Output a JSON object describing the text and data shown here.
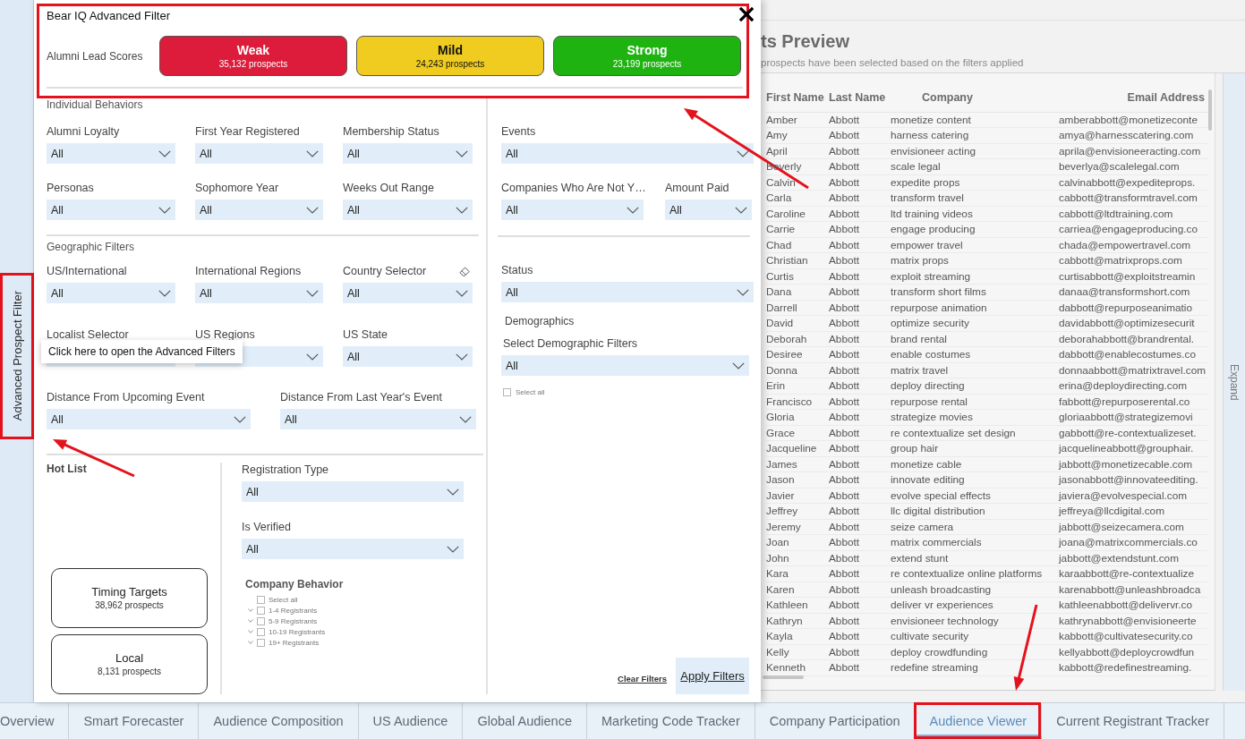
{
  "sidebar": {
    "label": "Advanced Prospect Filter"
  },
  "tooltip": {
    "text": "Click here to open the Advanced Filters"
  },
  "filter_panel": {
    "title": "Bear IQ Advanced Filter",
    "lead_scores": {
      "label": "Alumni Lead Scores",
      "buttons": [
        {
          "label": "Weak",
          "count": "35,132 prospects",
          "color": "#dc1c3a"
        },
        {
          "label": "Mild",
          "count": "24,243 prospects",
          "color": "#efcc1f"
        },
        {
          "label": "Strong",
          "count": "23,199 prospects",
          "color": "#1fb312"
        }
      ]
    },
    "individual_behaviors": {
      "heading": "Individual Behaviors",
      "filters": [
        {
          "label": "Alumni Loyalty",
          "value": "All"
        },
        {
          "label": "First Year Registered",
          "value": "All"
        },
        {
          "label": "Membership Status",
          "value": "All"
        },
        {
          "label": "Personas",
          "value": "All"
        },
        {
          "label": "Sophomore Year",
          "value": "All"
        },
        {
          "label": "Weeks Out Range",
          "value": "All"
        }
      ]
    },
    "geographic_filters": {
      "heading": "Geographic Filters",
      "filters": [
        {
          "label": "US/International",
          "value": "All",
          "clearable": false
        },
        {
          "label": "International Regions",
          "value": "All",
          "clearable": false
        },
        {
          "label": "Country Selector",
          "value": "All",
          "clearable": true
        },
        {
          "label": "Localist Selector",
          "clearable": false
        },
        {
          "label": "US Regions",
          "clearable": false
        },
        {
          "label": "US State",
          "value": "All",
          "clearable": false
        }
      ],
      "distance_filters": [
        {
          "label": "Distance From Upcoming Event",
          "value": "All"
        },
        {
          "label": "Distance From Last Year's Event",
          "value": "All"
        }
      ]
    },
    "hot_list": {
      "heading": "Hot List",
      "cards": [
        {
          "title": "Timing Targets",
          "count": "38,962 prospects"
        },
        {
          "title": "Local",
          "count": "8,131 prospects"
        }
      ]
    },
    "registration_filters": [
      {
        "label": "Registration Type",
        "value": "All"
      },
      {
        "label": "Is Verified",
        "value": "All"
      }
    ],
    "company_behavior": {
      "heading": "Company Behavior",
      "items": [
        {
          "kind": "all",
          "label": "Select all",
          "checked": false
        },
        {
          "kind": "group",
          "label": "1-4 Registrants",
          "checked": false
        },
        {
          "kind": "group",
          "label": "5-9 Registrants",
          "checked": false
        },
        {
          "kind": "group",
          "label": "10-19 Registrants",
          "checked": false
        },
        {
          "kind": "group",
          "label": "19+ Registrants",
          "checked": false
        }
      ]
    },
    "events_filter": {
      "label": "Events",
      "value": "All"
    },
    "company_filters": [
      {
        "label": "Companies Who Are Not Y…",
        "value": "All"
      },
      {
        "label": "Amount Paid",
        "value": "All"
      }
    ],
    "status_filter": {
      "label": "Status",
      "value": "All"
    },
    "demographics": {
      "heading": "Demographics",
      "filter": {
        "label": "Select Demographic Filters",
        "value": "All"
      },
      "select_all": {
        "label": "Select all",
        "checked": false
      }
    },
    "clear_link": "Clear Filters",
    "apply_button": "Apply Filters"
  },
  "preview": {
    "title": "ts Preview",
    "subtitle": "prospects have been selected based on the filters applied",
    "expand": "Expand",
    "table": {
      "columns": [
        "First Name",
        "Last Name",
        "Company",
        "Email Address"
      ],
      "rows": [
        [
          "Amber",
          "Abbott",
          "monetize content",
          "amberabbott@monetizeconte"
        ],
        [
          "Amy",
          "Abbott",
          "harness catering",
          "amya@harnesscatering.com"
        ],
        [
          "April",
          "Abbott",
          "envisioneer acting",
          "aprila@envisioneeracting.com"
        ],
        [
          "Beverly",
          "Abbott",
          "scale legal",
          "beverlya@scalelegal.com"
        ],
        [
          "Calvin",
          "Abbott",
          "expedite props",
          "calvinabbott@expediteprops."
        ],
        [
          "Carla",
          "Abbott",
          "transform travel",
          "cabbott@transformtravel.com"
        ],
        [
          "Caroline",
          "Abbott",
          "ltd training videos",
          "cabbott@ltdtraining.com"
        ],
        [
          "Carrie",
          "Abbott",
          "engage producing",
          "carriea@engageproducing.co"
        ],
        [
          "Chad",
          "Abbott",
          "empower travel",
          "chada@empowertravel.com"
        ],
        [
          "Christian",
          "Abbott",
          "matrix props",
          "cabbott@matrixprops.com"
        ],
        [
          "Curtis",
          "Abbott",
          "exploit streaming",
          "curtisabbott@exploitstreamin"
        ],
        [
          "Dana",
          "Abbott",
          "transform short films",
          "danaa@transformshort.com"
        ],
        [
          "Darrell",
          "Abbott",
          "repurpose animation",
          "dabbott@repurposeanimatio"
        ],
        [
          "David",
          "Abbott",
          "optimize security",
          "davidabbott@optimizesecurit"
        ],
        [
          "Deborah",
          "Abbott",
          "brand rental",
          "deborahabbott@brandrental."
        ],
        [
          "Desiree",
          "Abbott",
          "enable costumes",
          "dabbott@enablecostumes.co"
        ],
        [
          "Donna",
          "Abbott",
          "matrix travel",
          "donnaabbott@matrixtravel.com"
        ],
        [
          "Erin",
          "Abbott",
          "deploy directing",
          "erina@deploydirecting.com"
        ],
        [
          "Francisco",
          "Abbott",
          "repurpose rental",
          "fabbott@repurposerental.co"
        ],
        [
          "Gloria",
          "Abbott",
          "strategize movies",
          "gloriaabbott@strategizemovi"
        ],
        [
          "Grace",
          "Abbott",
          "re contextualize set design",
          "gabbott@re-contextualizeset."
        ],
        [
          "Jacqueline",
          "Abbott",
          "group hair",
          "jacquelineabbott@grouphair."
        ],
        [
          "James",
          "Abbott",
          "monetize cable",
          "jabbott@monetizecable.com"
        ],
        [
          "Jason",
          "Abbott",
          "innovate editing",
          "jasonabbott@innovateediting."
        ],
        [
          "Javier",
          "Abbott",
          "evolve special effects",
          "javiera@evolvespecial.com"
        ],
        [
          "Jeffrey",
          "Abbott",
          "llc digital distribution",
          "jeffreya@llcdigital.com"
        ],
        [
          "Jeremy",
          "Abbott",
          "seize camera",
          "jabbott@seizecamera.com"
        ],
        [
          "Joan",
          "Abbott",
          "matrix commercials",
          "joana@matrixcommercials.co"
        ],
        [
          "John",
          "Abbott",
          "extend stunt",
          "jabbott@extendstunt.com"
        ],
        [
          "Kara",
          "Abbott",
          "re contextualize online platforms",
          "karaabbott@re-contextualize"
        ],
        [
          "Karen",
          "Abbott",
          "unleash broadcasting",
          "karenabbott@unleashbroadca"
        ],
        [
          "Kathleen",
          "Abbott",
          "deliver vr experiences",
          "kathleenabbott@delivervr.co"
        ],
        [
          "Kathryn",
          "Abbott",
          "envisioneer technology",
          "kathrynabbott@envisioneerte"
        ],
        [
          "Kayla",
          "Abbott",
          "cultivate security",
          "kabbott@cultivatesecurity.co"
        ],
        [
          "Kelly",
          "Abbott",
          "deploy crowdfunding",
          "kellyabbott@deploycrowdfun"
        ],
        [
          "Kenneth",
          "Abbott",
          "redefine streaming",
          "kabbott@redefinestreaming."
        ]
      ]
    }
  },
  "tabs": [
    {
      "label": "Overview",
      "selected": false
    },
    {
      "label": "Smart Forecaster",
      "selected": false
    },
    {
      "label": "Audience Composition",
      "selected": false
    },
    {
      "label": "US Audience",
      "selected": false
    },
    {
      "label": "Global Audience",
      "selected": false
    },
    {
      "label": "Marketing Code Tracker",
      "selected": false
    },
    {
      "label": "Company Participation",
      "selected": false
    },
    {
      "label": "Audience Viewer",
      "selected": true
    },
    {
      "label": "Current Registrant Tracker",
      "selected": false
    }
  ]
}
